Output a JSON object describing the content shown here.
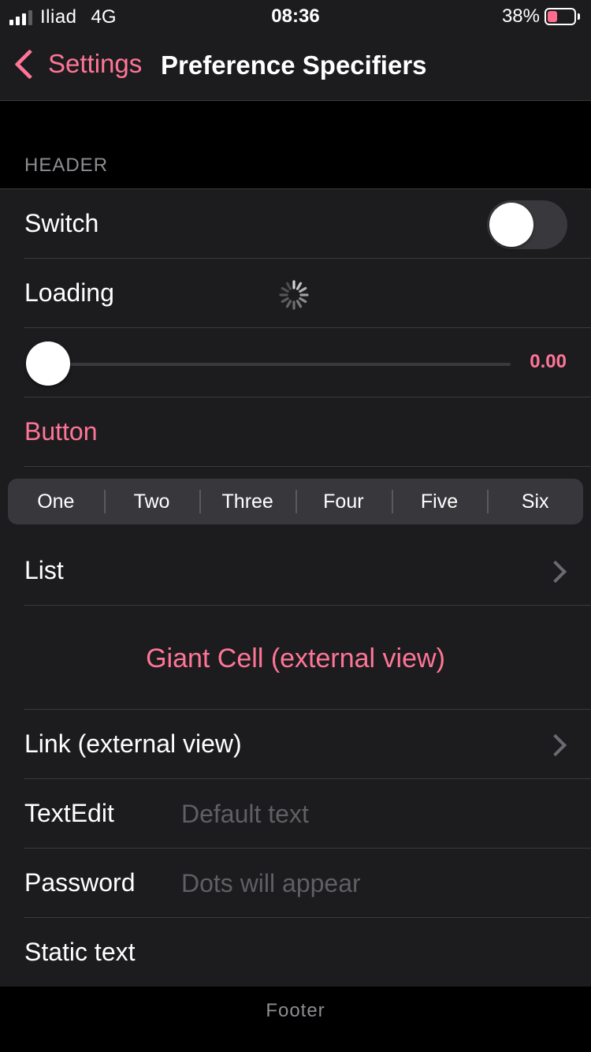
{
  "status_bar": {
    "carrier": "Iliad",
    "network": "4G",
    "time": "08:36",
    "battery_percent": "38%",
    "battery_level": 0.38,
    "signal_bars_filled": 3,
    "signal_bars_total": 4
  },
  "nav": {
    "back_label": "Settings",
    "title": "Preference Specifiers",
    "back_icon": "chevron-left-icon"
  },
  "section": {
    "header": "HEADER",
    "footer": "Footer"
  },
  "rows": {
    "switch": {
      "label": "Switch",
      "on": false
    },
    "loading": {
      "label": "Loading"
    },
    "slider": {
      "value_text": "0.00",
      "value": 0.0
    },
    "button": {
      "label": "Button"
    },
    "segmented": {
      "segments": [
        "One",
        "Two",
        "Three",
        "Four",
        "Five",
        "Six"
      ]
    },
    "list": {
      "label": "List"
    },
    "giant_cell": {
      "label": "Giant Cell (external view)"
    },
    "link": {
      "label": "Link (external view)"
    },
    "text_edit": {
      "label": "TextEdit",
      "placeholder": "Default text",
      "value": ""
    },
    "password": {
      "label": "Password",
      "placeholder": "Dots will appear",
      "value": ""
    },
    "static_text": {
      "label": "Static text"
    }
  },
  "colors": {
    "accent": "#ff7597",
    "background": "#000000",
    "cell_background": "#1c1c1e",
    "separator": "#3a3a3c",
    "secondary_text": "#8d8d93"
  }
}
